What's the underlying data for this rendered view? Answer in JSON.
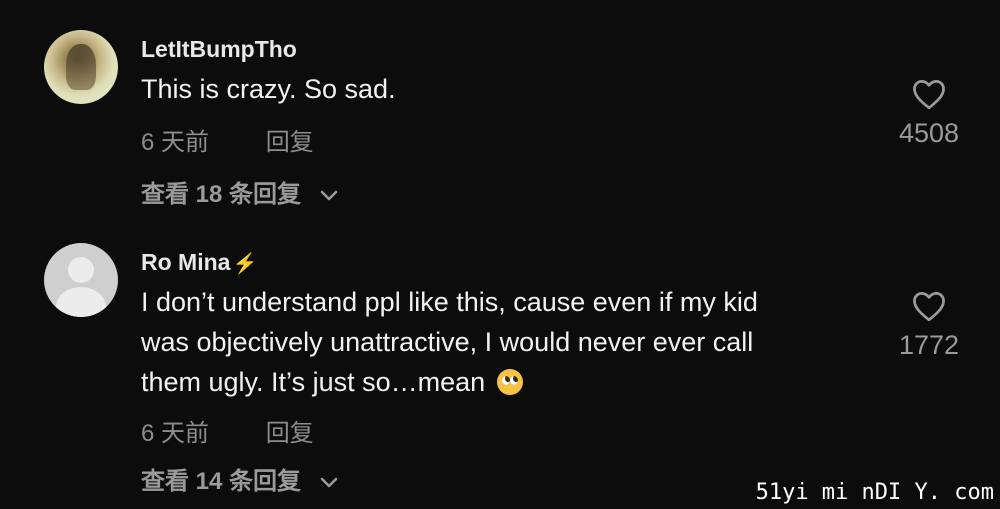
{
  "comments": [
    {
      "username": "LetItBumpTho",
      "text": "This is crazy. So sad.",
      "time": "6 天前",
      "reply_label": "回复",
      "view_replies": "查看 18 条回复",
      "likes": "4508",
      "avatar": "photo"
    },
    {
      "username": "Ro Mina",
      "badge": "⚡",
      "text_lines": [
        "I don’t understand ppl like this, cause even if my kid",
        "was objectively unattractive, I would never ever call",
        "them ugly. It’s just so…mean"
      ],
      "time": "6 天前",
      "reply_label": "回复",
      "view_replies": "查看 14 条回复",
      "likes": "1772",
      "avatar": "default",
      "emoji": "pleading-face-emoji"
    }
  ],
  "watermark": "51yi mi nDI Y. com",
  "colors": {
    "background": "#0c0c0c",
    "text": "#f2f2f2",
    "muted": "#8d8d8d",
    "bolt": "#f5c400"
  }
}
